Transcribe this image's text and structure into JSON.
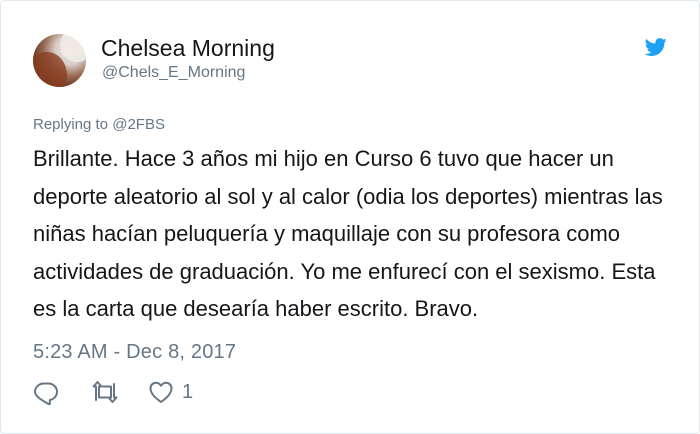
{
  "author": {
    "display_name": "Chelsea Morning",
    "handle": "@Chels_E_Morning"
  },
  "tweet": {
    "replying_to": "Replying to @2FBS",
    "text": "Brillante. Hace 3 años mi hijo en Curso 6 tuvo que hacer un deporte aleatorio al sol y al calor (odia los deportes) mientras las niñas hacían peluquería y maquillaje con su profesora como actividades de graduación. Yo me enfurecí con el sexismo. Esta es la carta que desearía haber escrito. Bravo.",
    "timestamp": "5:23 AM - Dec 8, 2017"
  },
  "actions": {
    "reply_icon": "reply-icon",
    "retweet_icon": "retweet-icon",
    "like_icon": "heart-icon",
    "like_count": "1"
  },
  "colors": {
    "text_primary": "#14171a",
    "text_secondary": "#657786",
    "brand_blue": "#1da1f2",
    "border": "#e1e8ed"
  }
}
